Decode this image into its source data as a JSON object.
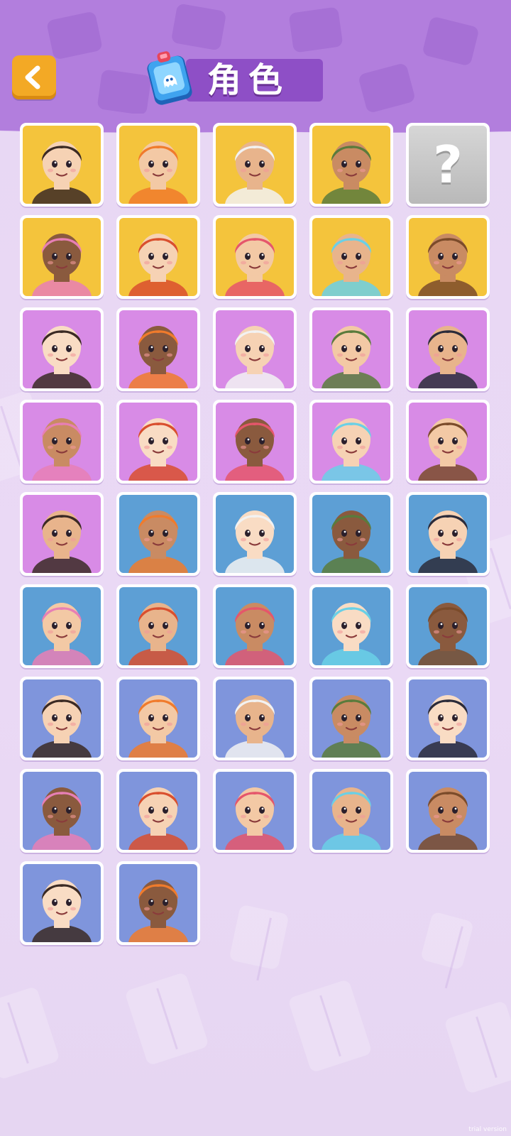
{
  "header": {
    "title": "角色",
    "back_icon": "chevron-left-icon",
    "title_icon": "character-card-icon"
  },
  "colors": {
    "header": "#b27edd",
    "title_banner": "#8e4fc6",
    "back_button": "#f3a925",
    "tier_gold": "#f4c43c",
    "tier_purple": "#d88be6",
    "tier_blue": "#5d9fd5",
    "tier_indigo": "#7f95dc",
    "locked": "#c4c4c4"
  },
  "characters": [
    {
      "tier": "gold",
      "icon": "goblin-man-avatar",
      "locked": false
    },
    {
      "tier": "gold",
      "icon": "hat-and-glasses-items-avatar",
      "locked": false
    },
    {
      "tier": "gold",
      "icon": "pink-hair-witch-avatar",
      "locked": false
    },
    {
      "tier": "gold",
      "icon": "jiangshi-zombie-avatar",
      "locked": false
    },
    {
      "tier": "locked",
      "icon": "question-mark-icon",
      "locked": true,
      "label": "?"
    },
    {
      "tier": "gold",
      "icon": "seal-explorer-avatar",
      "locked": false
    },
    {
      "tier": "gold",
      "icon": "cat-ear-girl-avatar",
      "locked": false
    },
    {
      "tier": "gold",
      "icon": "bun-hair-man-avatar",
      "locked": false
    },
    {
      "tier": "gold",
      "icon": "green-hair-hat-girl-avatar",
      "locked": false
    },
    {
      "tier": "gold",
      "icon": "leopard-gecko-avatar",
      "locked": false
    },
    {
      "tier": "purple",
      "icon": "cyan-hair-boy-avatar",
      "locked": false
    },
    {
      "tier": "purple",
      "icon": "braided-goth-girl-avatar",
      "locked": false
    },
    {
      "tier": "purple",
      "icon": "lynx-man-avatar",
      "locked": false
    },
    {
      "tier": "purple",
      "icon": "glasses-businessman-avatar",
      "locked": false
    },
    {
      "tier": "purple",
      "icon": "alpaca-avatar",
      "locked": false
    },
    {
      "tier": "purple",
      "icon": "corgi-avatar",
      "locked": false
    },
    {
      "tier": "purple",
      "icon": "hamster-avatar",
      "locked": false
    },
    {
      "tier": "purple",
      "icon": "tiger-beanie-avatar",
      "locked": false
    },
    {
      "tier": "purple",
      "icon": "stone-statue-man-avatar",
      "locked": false
    },
    {
      "tier": "purple",
      "icon": "ghost-bride-avatar",
      "locked": false
    },
    {
      "tier": "purple",
      "icon": "hotpot-avatar",
      "locked": false
    },
    {
      "tier": "blue",
      "icon": "pink-bun-girl-avatar",
      "locked": false
    },
    {
      "tier": "blue",
      "icon": "peace-sign-girl-avatar",
      "locked": false
    },
    {
      "tier": "blue",
      "icon": "headphone-girl-avatar",
      "locked": false
    },
    {
      "tier": "blue",
      "icon": "pink-hair-shy-girl-avatar",
      "locked": false
    },
    {
      "tier": "blue",
      "icon": "welder-man-avatar",
      "locked": false
    },
    {
      "tier": "blue",
      "icon": "martial-artist-avatar",
      "locked": false
    },
    {
      "tier": "blue",
      "icon": "orange-hair-clown-avatar",
      "locked": false
    },
    {
      "tier": "blue",
      "icon": "umbrella-girl-avatar",
      "locked": false
    },
    {
      "tier": "blue",
      "icon": "white-hair-man-avatar",
      "locked": false
    },
    {
      "tier": "indigo",
      "icon": "pigtail-glasses-girl-avatar",
      "locked": false
    },
    {
      "tier": "indigo",
      "icon": "sunglasses-man-avatar",
      "locked": false
    },
    {
      "tier": "indigo",
      "icon": "chef-cat-avatar",
      "locked": false
    },
    {
      "tier": "indigo",
      "icon": "bandana-man-avatar",
      "locked": false
    },
    {
      "tier": "indigo",
      "icon": "hood-boy-avatar",
      "locked": false
    },
    {
      "tier": "indigo",
      "icon": "astronaut-fish-avatar",
      "locked": false
    },
    {
      "tier": "indigo",
      "icon": "orange-robot-avatar",
      "locked": false
    },
    {
      "tier": "indigo",
      "icon": "glasses-lady-avatar",
      "locked": false
    },
    {
      "tier": "indigo",
      "icon": "chef-man-avatar",
      "locked": false
    },
    {
      "tier": "indigo",
      "icon": "smiling-auntie-avatar",
      "locked": false
    },
    {
      "tier": "indigo",
      "icon": "red-hair-boy-avatar",
      "locked": false
    },
    {
      "tier": "indigo",
      "icon": "panda-avatar",
      "locked": false
    }
  ],
  "watermark": "trial version"
}
